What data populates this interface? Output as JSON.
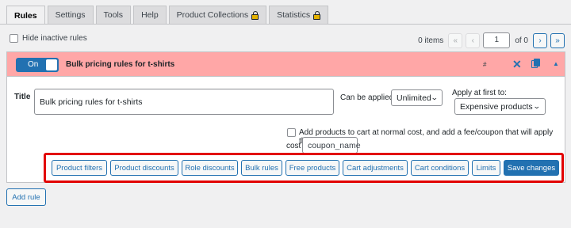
{
  "tabs": [
    {
      "label": "Rules",
      "active": true,
      "locked": false
    },
    {
      "label": "Settings",
      "active": false,
      "locked": false
    },
    {
      "label": "Tools",
      "active": false,
      "locked": false
    },
    {
      "label": "Help",
      "active": false,
      "locked": false
    },
    {
      "label": "Product Collections",
      "active": false,
      "locked": true
    },
    {
      "label": "Statistics",
      "active": false,
      "locked": true
    }
  ],
  "filters": {
    "hide_inactive_label": "Hide inactive rules",
    "hide_inactive_checked": false
  },
  "pagination": {
    "items_text": "0 items",
    "first": "«",
    "prev": "‹",
    "current_page": "1",
    "of_text": "of 0",
    "next": "›",
    "last": "»"
  },
  "rule": {
    "toggle_label": "On",
    "header_title": "Bulk pricing rules for t-shirts",
    "hash": "#",
    "title_label": "Title",
    "title_value": "Bulk pricing rules for t-shirts",
    "can_be_applied_label": "Can be applied:",
    "can_be_applied_value": "Unlimited",
    "apply_first_label": "Apply at first to:",
    "apply_first_value": "Expensive products",
    "add_products_text_line1": "Add products to cart at normal cost, and add a fee/coupon that will apply that",
    "add_products_text_line2": "cost",
    "coupon_placeholder": "coupon_name",
    "buttons": [
      "Product filters",
      "Product discounts",
      "Role discounts",
      "Bulk rules",
      "Free products",
      "Cart adjustments",
      "Cart conditions",
      "Limits"
    ],
    "save_label": "Save changes"
  },
  "add_rule_label": "Add rule",
  "colors": {
    "accent": "#2271b1",
    "header_bg": "#ffa7a7",
    "highlight_frame": "#e20000"
  }
}
